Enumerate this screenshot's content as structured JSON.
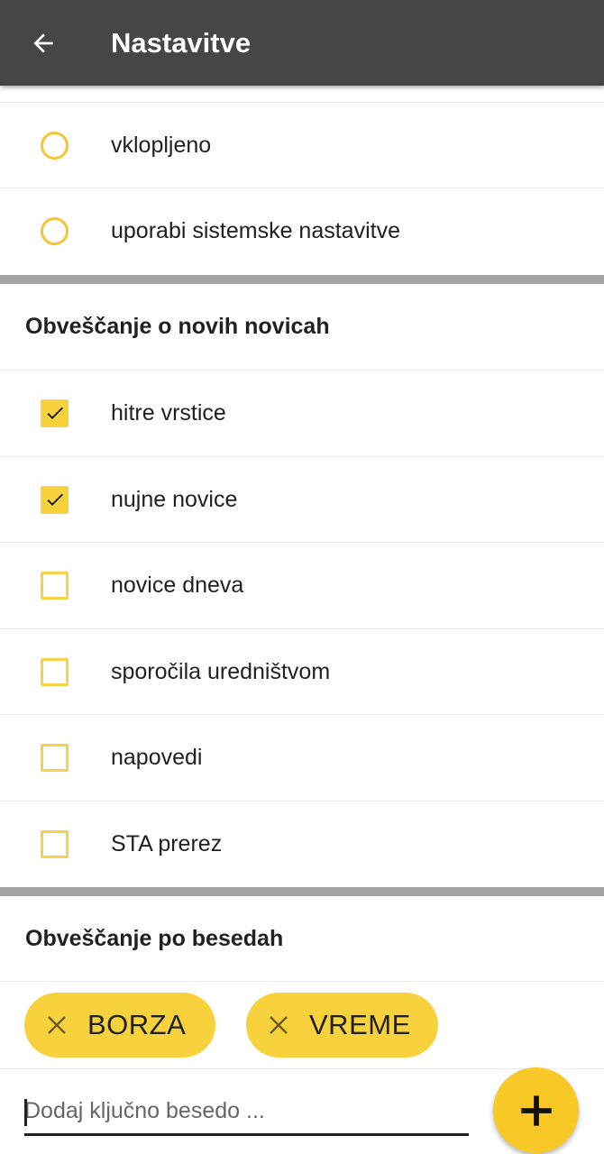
{
  "appbar": {
    "title": "Nastavitve",
    "back_icon": "arrow-left-icon",
    "background": "#464646"
  },
  "theme_options": [
    {
      "label": "vklopljeno",
      "selected": false
    },
    {
      "label": "uporabi sistemske nastavitve",
      "selected": false
    }
  ],
  "news_section": {
    "title": "Obveščanje o novih novicah",
    "items": [
      {
        "label": "hitre vrstice",
        "checked": true
      },
      {
        "label": "nujne novice",
        "checked": true
      },
      {
        "label": "novice dneva",
        "checked": false
      },
      {
        "label": "sporočila uredništvom",
        "checked": false
      },
      {
        "label": "napovedi",
        "checked": false
      },
      {
        "label": "STA prerez",
        "checked": false
      }
    ]
  },
  "keywords_section": {
    "title": "Obveščanje po besedah",
    "chips": [
      {
        "label": "BORZA",
        "icon": "close-icon"
      },
      {
        "label": "VREME",
        "icon": "close-icon"
      }
    ],
    "input_placeholder": "Dodaj ključno besedo ...",
    "input_value": "",
    "add_icon": "plus-icon"
  },
  "colors": {
    "accent": "#f8d23c",
    "fab": "#f8c926",
    "divider": "#a3a3a3"
  }
}
